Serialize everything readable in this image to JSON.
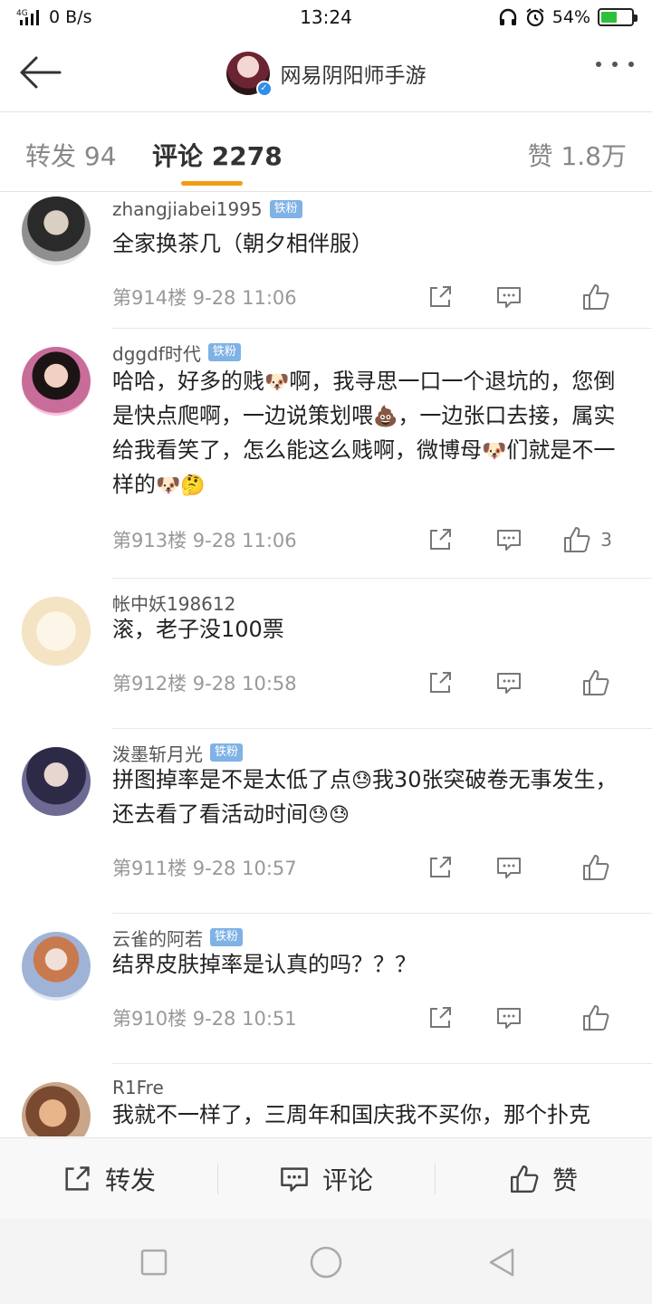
{
  "status_bar": {
    "network": "4G",
    "speed": "0 B/s",
    "time": "13:24",
    "battery": "54%",
    "battery_level": 0.54
  },
  "header": {
    "title": "网易阴阳师手游"
  },
  "tabs": {
    "repost": "转发 94",
    "comment": "评论 2278",
    "like": "赞 1.8万"
  },
  "comments": [
    {
      "username": "zhangjiabei1995",
      "badge": "铁粉",
      "text": "全家换茶几（朝夕相伴服）",
      "meta": "第914楼 9-28 11:06",
      "likes": ""
    },
    {
      "username": "dggdf时代",
      "badge": "铁粉",
      "text_parts": [
        "哈哈，好多的贱",
        "啊，我寻思一口一个退坑的，您倒是快点爬啊，一边说策划喂",
        "，一边张口去接，属实给我看笑了，怎么能这么贱啊，微博母",
        "们就是不一样的"
      ],
      "meta": "第913楼 9-28 11:06",
      "likes": "3"
    },
    {
      "username": "帐中妖198612",
      "badge": "",
      "text": "滚，老子没100票",
      "meta": "第912楼 9-28 10:58",
      "likes": ""
    },
    {
      "username": "泼墨斩月光",
      "badge": "铁粉",
      "text_parts": [
        "拼图掉率是不是太低了点",
        "我30张突破卷无事发生，还去看了看活动时间"
      ],
      "meta": "第911楼 9-28 10:57",
      "likes": ""
    },
    {
      "username": "云雀的阿若",
      "badge": "铁粉",
      "text": "结界皮肤掉率是认真的吗？？？",
      "meta": "第910楼 9-28 10:51",
      "likes": ""
    },
    {
      "username": "R1Fre",
      "badge": "",
      "text": "我就不一样了，三周年和国庆我不买你，那个扑克",
      "meta": "",
      "likes": ""
    }
  ],
  "emojis": {
    "dog": "🐶",
    "poop": "💩",
    "thinking": "🤔",
    "sweat": "😓"
  },
  "toolbar": {
    "repost": "转发",
    "comment": "评论",
    "like": "赞"
  },
  "colors": {
    "accent": "#f39c12",
    "badge": "#7fb2e5",
    "verified": "#2e8ee8"
  }
}
